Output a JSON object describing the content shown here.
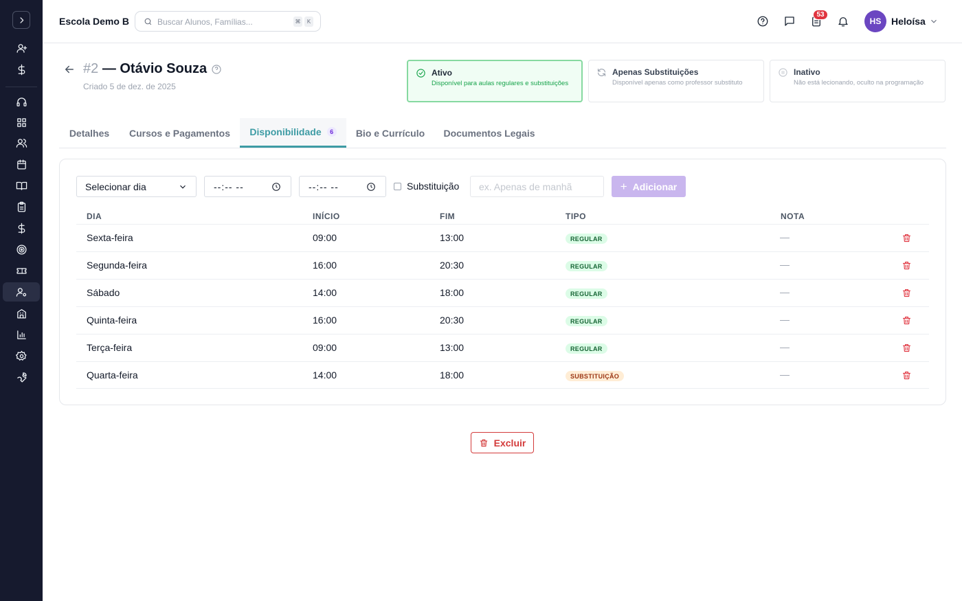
{
  "app": {
    "school_name": "Escola Demo B"
  },
  "search": {
    "placeholder": "Buscar Alunos, Famílias...",
    "shortcut_keys": [
      "⌘",
      "K"
    ]
  },
  "topbar": {
    "notification_badge": "53"
  },
  "user": {
    "initials": "HS",
    "name": "Heloísa",
    "avatar_color": "#6b46c1"
  },
  "sidebar": {
    "items": [
      {
        "icon": "user-plus-icon"
      },
      {
        "icon": "dollar-icon"
      },
      {
        "icon": "headset-icon"
      },
      {
        "icon": "grid-icon"
      },
      {
        "icon": "users-icon"
      },
      {
        "icon": "calendar-icon"
      },
      {
        "icon": "book-icon"
      },
      {
        "icon": "clipboard-icon"
      },
      {
        "icon": "dollar-icon"
      },
      {
        "icon": "target-icon"
      },
      {
        "icon": "ticket-icon"
      },
      {
        "icon": "user-cog-icon",
        "active": true
      },
      {
        "icon": "building-icon"
      },
      {
        "icon": "bar-chart-icon"
      },
      {
        "icon": "gear-icon"
      },
      {
        "icon": "wrench-icon"
      }
    ]
  },
  "teacher": {
    "number": "#2",
    "name_prefix": "—",
    "name": "Otávio Souza",
    "created": "Criado 5 de dez. de 2025"
  },
  "status_options": [
    {
      "title": "Ativo",
      "description": "Disponível para aulas regulares e substituições",
      "selected": true
    },
    {
      "title": "Apenas Substituições",
      "description": "Disponível apenas como professor substituto",
      "selected": false
    },
    {
      "title": "Inativo",
      "description": "Não está lecionando, oculto na programação",
      "selected": false
    }
  ],
  "tabs": [
    {
      "label": "Detalhes"
    },
    {
      "label": "Cursos e Pagamentos"
    },
    {
      "label": "Disponibilidade",
      "count": "6",
      "active": true
    },
    {
      "label": "Bio e Currículo"
    },
    {
      "label": "Documentos Legais"
    }
  ],
  "form": {
    "day_select": "Selecionar dia",
    "start_time": "--:-- --",
    "end_time": "--:-- --",
    "substitution_label": "Substituição",
    "substitution_checked": false,
    "note_placeholder": "ex. Apenas de manhã",
    "add_label": "Adicionar"
  },
  "table": {
    "headers": [
      "DIA",
      "INÍCIO",
      "FIM",
      "TIPO",
      "NOTA"
    ],
    "rows": [
      {
        "day": "Sexta-feira",
        "start": "09:00",
        "end": "13:00",
        "type": "REGULAR",
        "note": "—"
      },
      {
        "day": "Segunda-feira",
        "start": "16:00",
        "end": "20:30",
        "type": "REGULAR",
        "note": "—"
      },
      {
        "day": "Sábado",
        "start": "14:00",
        "end": "18:00",
        "type": "REGULAR",
        "note": "—"
      },
      {
        "day": "Quinta-feira",
        "start": "16:00",
        "end": "20:30",
        "type": "REGULAR",
        "note": "—"
      },
      {
        "day": "Terça-feira",
        "start": "09:00",
        "end": "13:00",
        "type": "REGULAR",
        "note": "—"
      },
      {
        "day": "Quarta-feira",
        "start": "14:00",
        "end": "18:00",
        "type": "SUBSTITUIÇÃO",
        "note": "—"
      }
    ]
  },
  "actions": {
    "delete_label": "Excluir"
  },
  "colors": {
    "sidebar_bg": "#161a2e",
    "accent_teal": "#3d9ba4",
    "active_green": "#16a34a",
    "danger": "#d33a3a",
    "add_button": "#c9b6ee"
  }
}
